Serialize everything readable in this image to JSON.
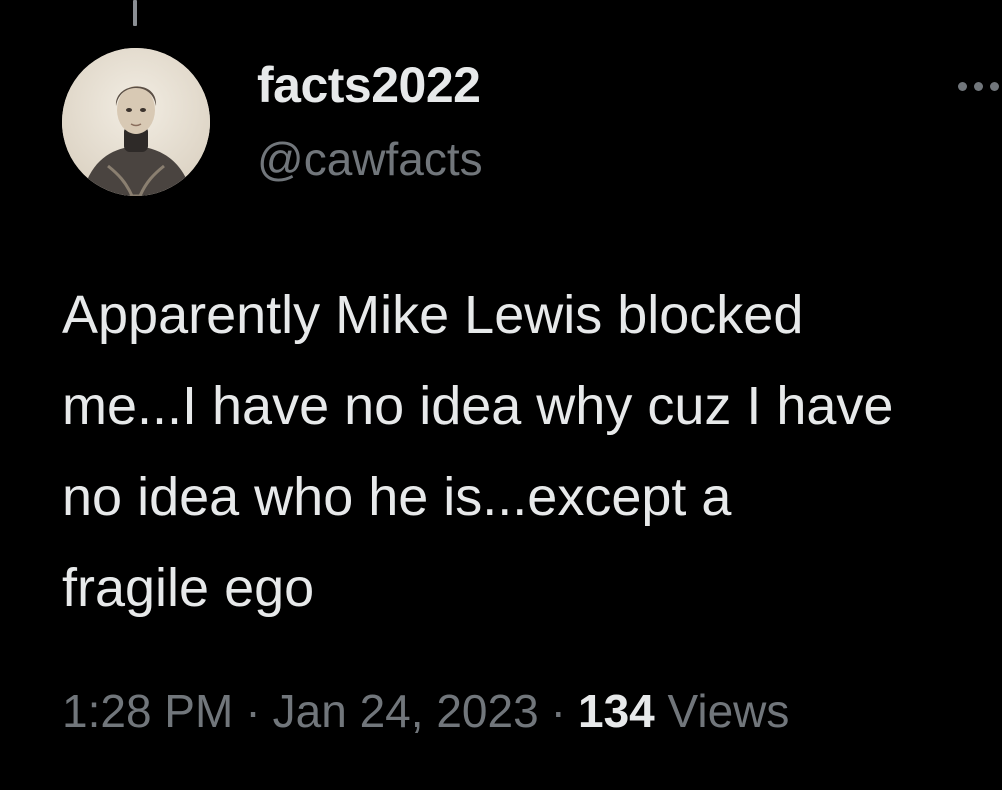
{
  "tweet": {
    "author": {
      "display_name": "facts2022",
      "handle": "@cawfacts",
      "avatar_icon": "vintage-portrait-avatar"
    },
    "text_lines": [
      "Apparently Mike Lewis blocked",
      "me...I have no idea why cuz I have",
      "no idea who he is...except a",
      "fragile ego"
    ],
    "time": "1:28 PM",
    "separator": "·",
    "date": "Jan 24, 2023",
    "views_count": "134",
    "views_label": "Views",
    "more_icon": "more-horizontal-icon"
  },
  "colors": {
    "background": "#000000",
    "primary_text": "#e7e9ea",
    "secondary_text": "#71767b"
  }
}
